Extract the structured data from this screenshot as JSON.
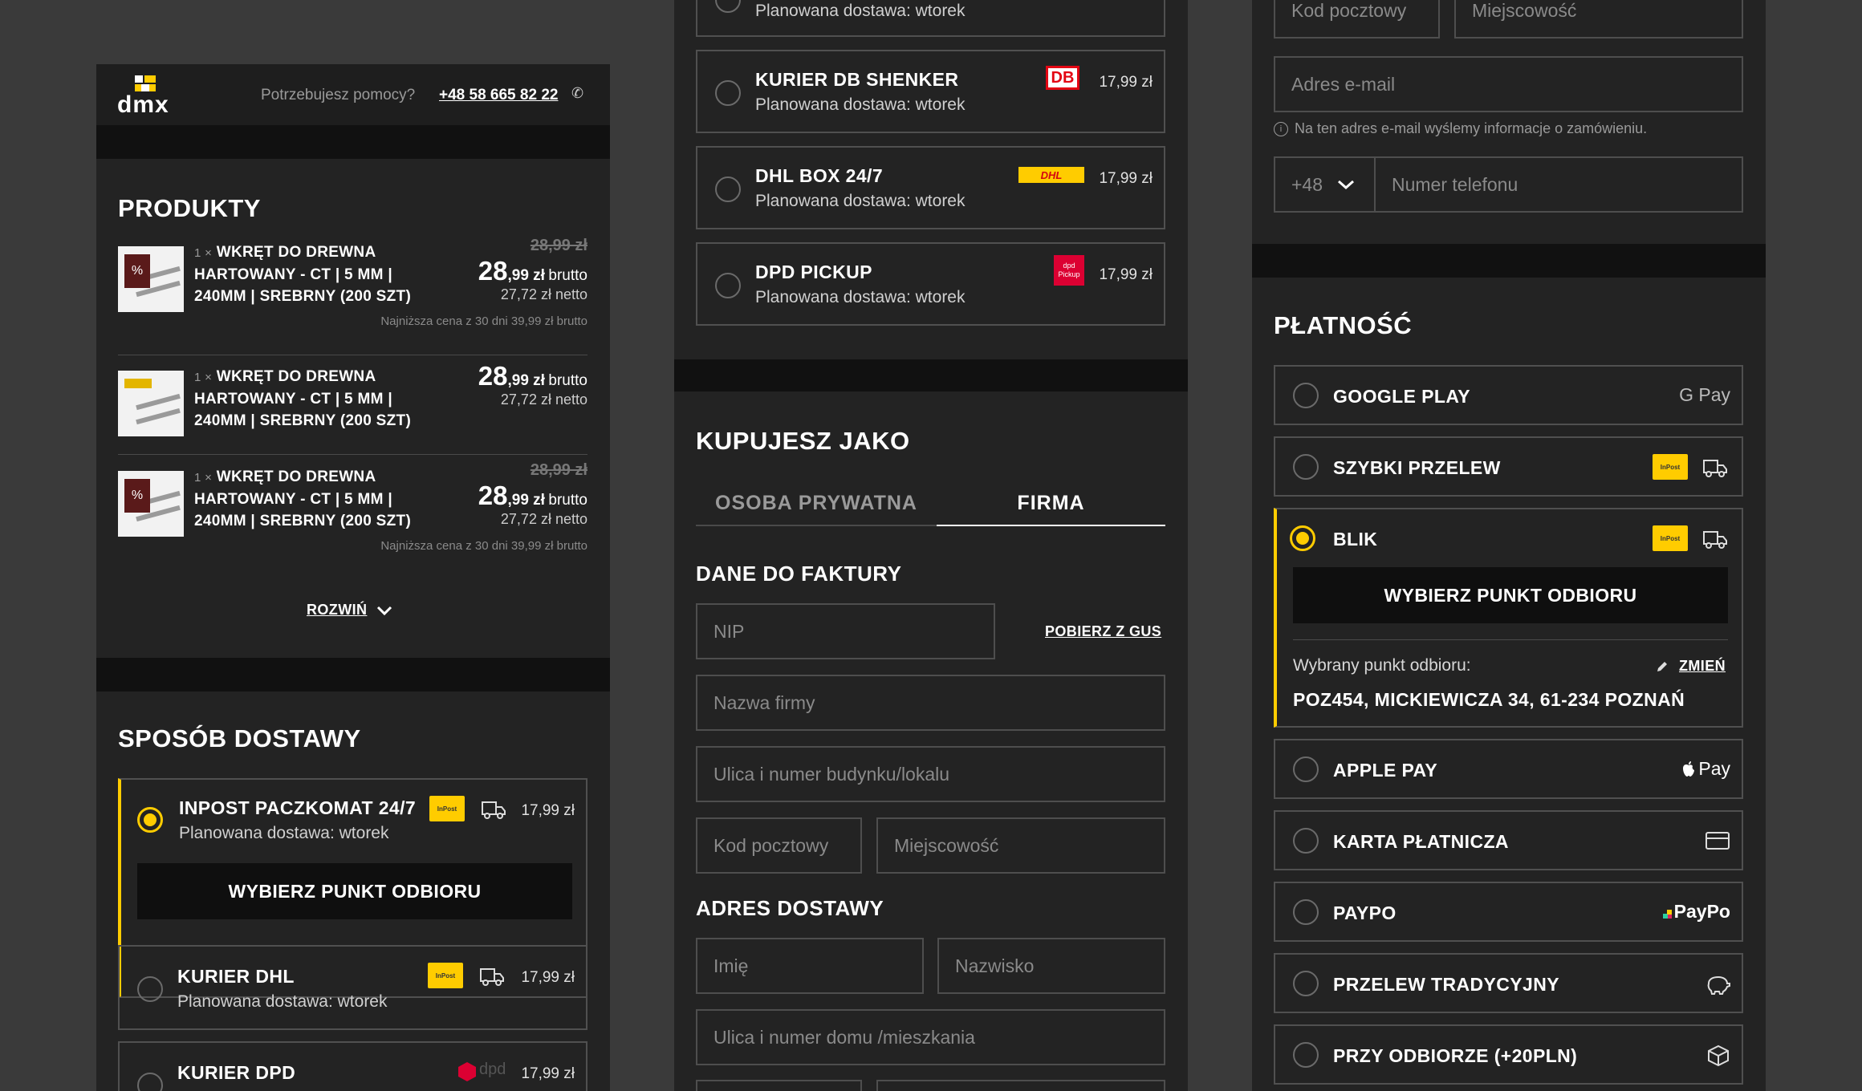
{
  "colors": {
    "accent": "#ffcc00",
    "panel": "#232323",
    "background": "#3a3a3a",
    "dark_band": "#111111",
    "dhl_red": "#d40511",
    "dpd_red": "#dc0032"
  },
  "left": {
    "logo": "dmx",
    "help_text": "Potrzebujesz pomocy?",
    "phone": "+48 58 665 82 22",
    "products_title": "PRODUKTY",
    "products": [
      {
        "qty": "1 ×",
        "name_lines": [
          "WKRĘT DO DREWNA",
          "HARTOWANY - CT | 5 MM |",
          "240MM | SREBRNY (200 SZT)"
        ],
        "old_price": "28,99 zł",
        "price_int": "28",
        "price_dec": ",99 zł",
        "brutto": "brutto",
        "netto": "27,72 zł netto",
        "lowest": "Najniższa cena z 30 dni 39,99 zł brutto",
        "badge": "%"
      },
      {
        "qty": "1 ×",
        "name_lines": [
          "WKRĘT DO DREWNA",
          "HARTOWANY - CT | 5 MM |",
          "240MM | SREBRNY (200 SZT)"
        ],
        "old_price": "",
        "price_int": "28",
        "price_dec": ",99 zł",
        "brutto": "brutto",
        "netto": "27,72 zł netto",
        "lowest": "",
        "badge": ""
      },
      {
        "qty": "1 ×",
        "name_lines": [
          "WKRĘT DO DREWNA",
          "HARTOWANY - CT | 5 MM |",
          "240MM | SREBRNY (200 SZT)"
        ],
        "old_price": "28,99 zł",
        "price_int": "28",
        "price_dec": ",99 zł",
        "brutto": "brutto",
        "netto": "27,72 zł netto",
        "lowest": "Najniższa cena z 30 dni 39,99 zł brutto",
        "badge": "%"
      }
    ],
    "expand_label": "ROZWIŃ",
    "delivery_title": "SPOSÓB DOSTAWY",
    "delivery": [
      {
        "title": "INPOST PACZKOMAT 24/7",
        "sub": "Planowana dostawa: wtorek",
        "price": "17,99 zł",
        "selected": true,
        "button": "WYBIERZ PUNKT ODBIORU"
      },
      {
        "title": "KURIER DHL",
        "sub": "Planowana dostawa: wtorek",
        "price": "17,99 zł",
        "selected": false
      },
      {
        "title": "KURIER DPD",
        "sub": "",
        "price": "17,99 zł",
        "selected": false,
        "logo_text": "dpd"
      }
    ]
  },
  "middle": {
    "top_sub": "Planowana dostawa: wtorek",
    "delivery": [
      {
        "title": "KURIER DB SHENKER",
        "sub": "Planowana dostawa: wtorek",
        "price": "17,99 zł",
        "logo": "DB"
      },
      {
        "title": "DHL BOX 24/7",
        "sub": "Planowana dostawa: wtorek",
        "price": "17,99 zł",
        "logo": "DHL"
      },
      {
        "title": "DPD PICKUP",
        "sub": "Planowana dostawa: wtorek",
        "price": "17,99 zł",
        "logo": "dpd Pickup"
      }
    ],
    "buy_as_title": "KUPUJESZ JAKO",
    "tabs": [
      {
        "label": "OSOBA PRYWATNA",
        "active": false
      },
      {
        "label": "FIRMA",
        "active": true
      }
    ],
    "invoice_title": "DANE DO FAKTURY",
    "nip_placeholder": "NIP",
    "gus_link": "POBIERZ Z GUS",
    "company_placeholder": "Nazwa firmy",
    "street_placeholder": "Ulica i numer budynku/lokalu",
    "postcode_placeholder": "Kod pocztowy",
    "city_placeholder": "Miejscowość",
    "shipping_title": "ADRES DOSTAWY",
    "firstname_placeholder": "Imię",
    "lastname_placeholder": "Nazwisko",
    "ship_street_placeholder": "Ulica i numer domu /mieszkania"
  },
  "right": {
    "postcode_placeholder": "Kod pocztowy",
    "city_placeholder": "Miejscowość",
    "email_placeholder": "Adres e-mail",
    "email_hint": "Na ten adres e-mail wyślemy informacje o zamówieniu.",
    "phone_prefix": "+48",
    "phone_placeholder": "Numer telefonu",
    "payment_title": "PŁATNOŚĆ",
    "payments": [
      {
        "title": "GOOGLE PLAY",
        "logo": "G Pay",
        "selected": false
      },
      {
        "title": "SZYBKI PRZELEW",
        "logo": "inpost",
        "selected": false
      },
      {
        "title": "BLIK",
        "logo": "inpost",
        "selected": true
      },
      {
        "title": "APPLE PAY",
        "logo": " Pay",
        "selected": false
      },
      {
        "title": "KARTA PŁATNICZA",
        "logo": "card",
        "selected": false
      },
      {
        "title": "PAYPO",
        "logo": "PayPo",
        "selected": false
      },
      {
        "title": "PRZELEW TRADYCYJNY",
        "logo": "piggy",
        "selected": false
      },
      {
        "title": "PRZY ODBIORZE (+20PLN)",
        "logo": "box",
        "selected": false
      }
    ],
    "blik_button": "WYBIERZ PUNKT ODBIORU",
    "chosen_label": "Wybrany punkt odbioru:",
    "change_link": "ZMIEŃ",
    "chosen_address": "POZ454, MICKIEWICZA 34, 61-234 POZNAŃ"
  }
}
